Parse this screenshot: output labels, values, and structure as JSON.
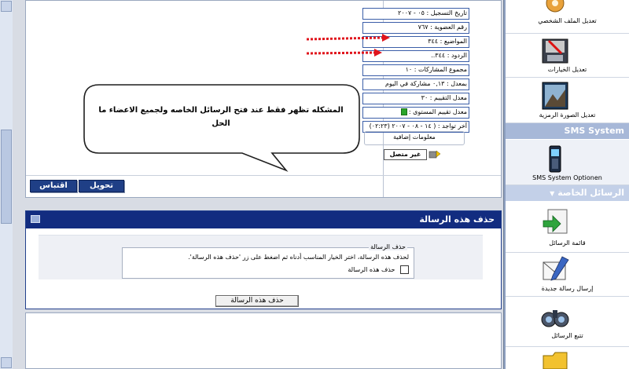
{
  "post": {
    "info": [
      "تاريخ التسجيل : ٠٥ - ٢٠٠٧",
      "رقم العضوية : ٧٦٧",
      "المواضيع : ٣٤٤",
      "الردود : ٣٤٤..",
      "مجموع المشاركات : ١٠",
      "بمعدل : ٠,١٣ مشاركة في اليوم",
      "معدل التقييم : ٣٠",
      "معدل تقييم المستوى :",
      "آخر تواجد : ( ١٤ - ٠٨ - ٢٠٠٧ (٠٢:٢٣)"
    ],
    "extra_info": "معلومات إضافية",
    "status": "غير متصل",
    "quote_button": "اقتباس",
    "convert_button": "تحويل"
  },
  "callout": {
    "line1": "المشكله تظهر فقط عند فتح الرسائل الخاصه ولجميع الاعضاء ما",
    "line2": "الحل"
  },
  "delete_panel": {
    "title": "حذف هذه الرسالة",
    "legend": "حذف الرسالة",
    "description": "لحذف هذه الرسالة، اختر الخيار المناسب أدناه ثم اضغط على زر 'حذف هذه الرسالة'.",
    "checkbox_label": "حذف هذه الرسالة",
    "button": "حذف هذه الرسالة"
  },
  "sidebar": {
    "edit_profile": "تعديل الملف الشخصي",
    "edit_options": "تعديل الخيارات",
    "edit_avatar": "تعديل الصورة الرمزية",
    "sms_header": "SMS System",
    "sms_options": "SMS System Optionen",
    "pm_header": "الرسائل الخاصة",
    "pm_list": "قائمة الرسائل",
    "pm_send": "إرسال رسالة جديدة",
    "pm_track": "تتبع الرسائل"
  },
  "colors": {
    "arrow": "#e0141c",
    "header_blue": "#122c80",
    "button_blue": "#1f3f86"
  }
}
